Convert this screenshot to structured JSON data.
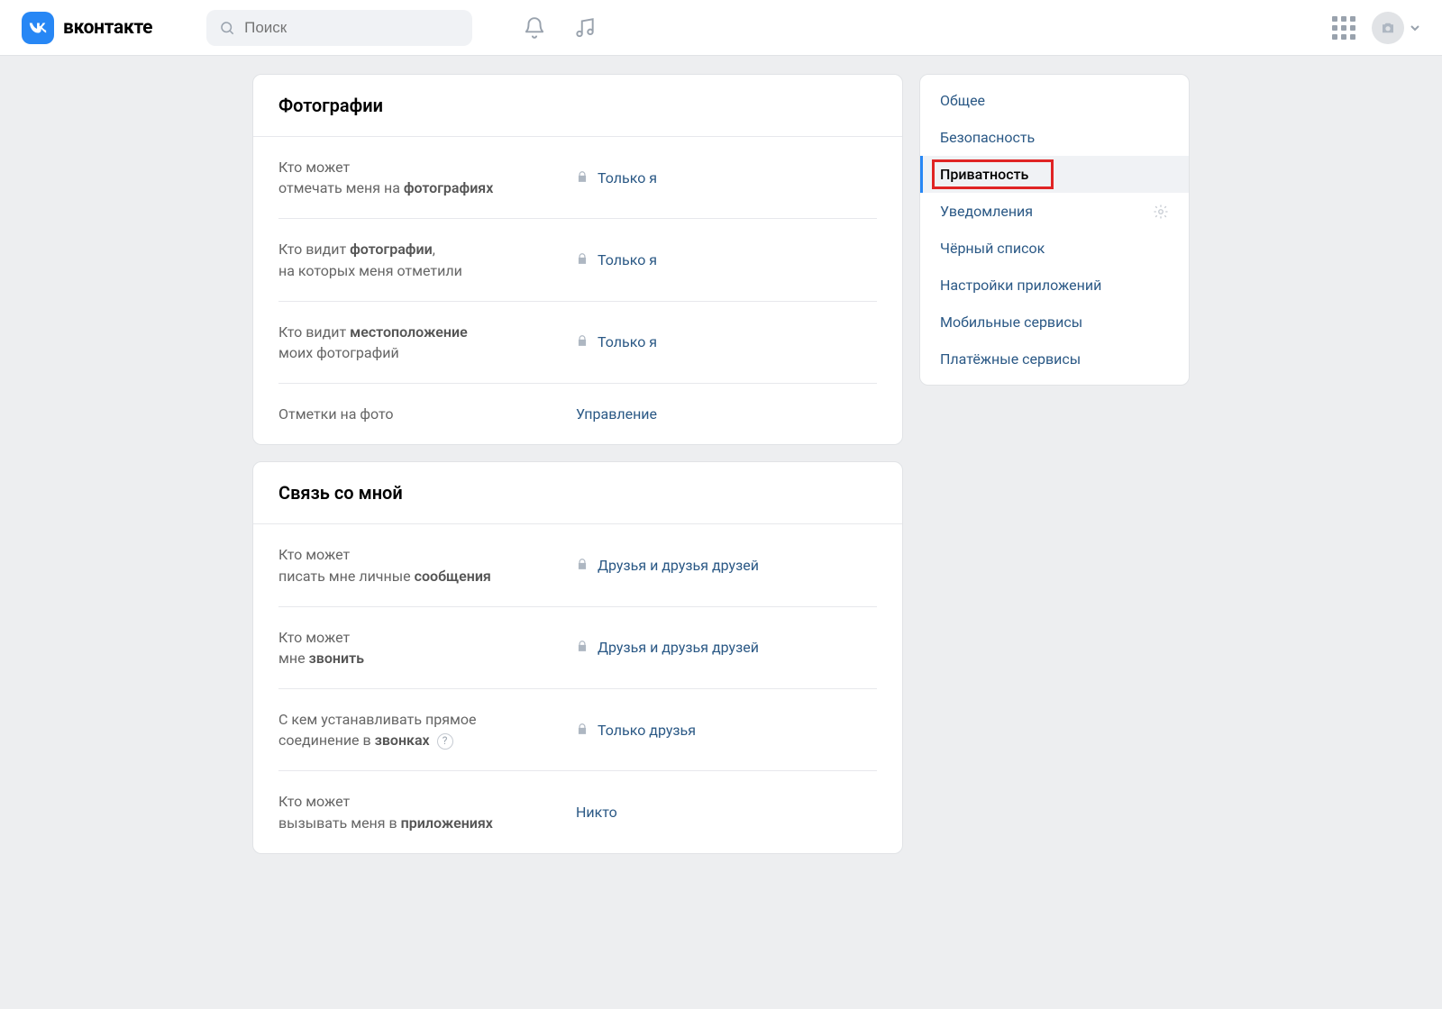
{
  "header": {
    "brand": "вконтакте",
    "search_placeholder": "Поиск"
  },
  "sections": [
    {
      "title": "Фотографии",
      "rows": [
        {
          "label_html": "Кто может<br>отмечать меня на <b>фотографиях</b>",
          "value": "Только я",
          "locked": true
        },
        {
          "label_html": "Кто видит <b>фотографии</b>,<br>на которых меня отметили",
          "value": "Только я",
          "locked": true
        },
        {
          "label_html": "Кто видит <b>местоположение</b><br>моих фотографий",
          "value": "Только я",
          "locked": true
        },
        {
          "label_html": "Отметки на фото",
          "value": "Управление",
          "locked": false
        }
      ]
    },
    {
      "title": "Связь со мной",
      "rows": [
        {
          "label_html": "Кто может<br>писать мне личные <b>сообщения</b>",
          "value": "Друзья и друзья друзей",
          "locked": true
        },
        {
          "label_html": "Кто может<br>мне <b>звонить</b>",
          "value": "Друзья и друзья друзей",
          "locked": true
        },
        {
          "label_html": "С кем устанавливать прямое<br>соединение в <b>звонках</b> <span class=\"help-icon\">?</span>",
          "value": "Только друзья",
          "locked": true
        },
        {
          "label_html": "Кто может<br>вызывать меня в <b>приложениях</b>",
          "value": "Никто",
          "locked": false
        }
      ]
    }
  ],
  "sidebar": {
    "items": [
      {
        "label": "Общее",
        "active": false,
        "highlighted": false,
        "gear": false
      },
      {
        "label": "Безопасность",
        "active": false,
        "highlighted": false,
        "gear": false
      },
      {
        "label": "Приватность",
        "active": true,
        "highlighted": true,
        "gear": false
      },
      {
        "label": "Уведомления",
        "active": false,
        "highlighted": false,
        "gear": true
      },
      {
        "label": "Чёрный список",
        "active": false,
        "highlighted": false,
        "gear": false
      },
      {
        "label": "Настройки приложений",
        "active": false,
        "highlighted": false,
        "gear": false
      },
      {
        "label": "Мобильные сервисы",
        "active": false,
        "highlighted": false,
        "gear": false
      },
      {
        "label": "Платёжные сервисы",
        "active": false,
        "highlighted": false,
        "gear": false
      }
    ]
  }
}
